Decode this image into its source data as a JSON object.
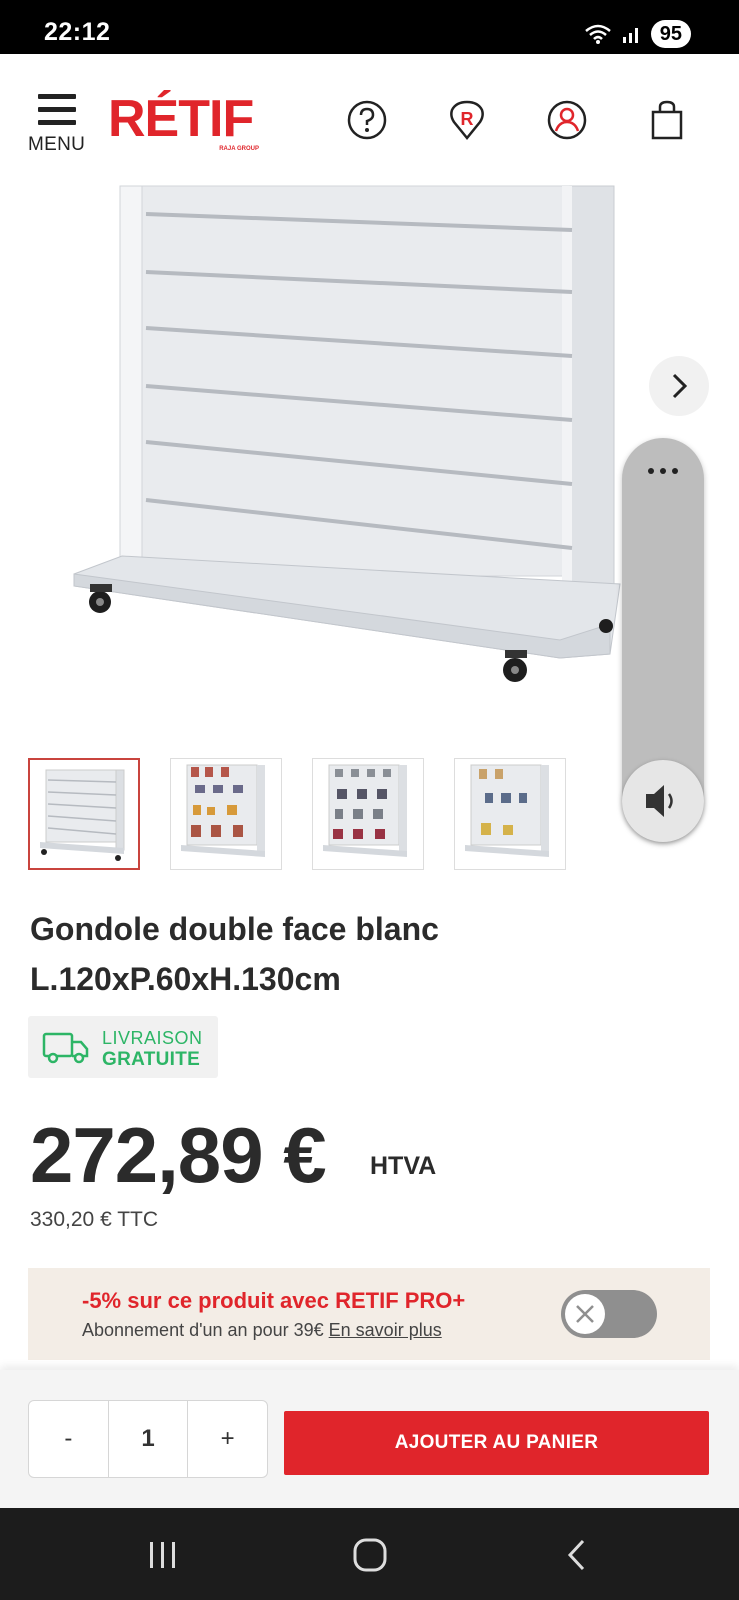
{
  "status_bar": {
    "time": "22:12",
    "battery": "95"
  },
  "header": {
    "menu_label": "MENU",
    "logo_text": "RÉTIF",
    "logo_subtext": "RAJA GROUP",
    "brand_color": "#e0252b",
    "icons": [
      "help-icon",
      "store-locator-icon",
      "account-icon",
      "cart-icon"
    ]
  },
  "product": {
    "title_line1": "Gondole double face blanc",
    "title_line2": "L.120xP.60xH.130cm",
    "delivery_line1": "LIVRAISON",
    "delivery_line2": "GRATUITE",
    "delivery_color": "#2db566",
    "price": "272,89 €",
    "price_unit": "HTVA",
    "price_ttc": "330,20 € TTC",
    "thumbnail_count": 4,
    "active_thumbnail": 1
  },
  "promo": {
    "title": "-5% sur ce produit avec RETIF PRO+",
    "subtitle": "Abonnement d'un an pour 39€",
    "link": "En savoir plus",
    "toggle_on": false
  },
  "cart": {
    "minus": "-",
    "quantity": "1",
    "plus": "+",
    "add_button": "AJOUTER AU PANIER"
  }
}
